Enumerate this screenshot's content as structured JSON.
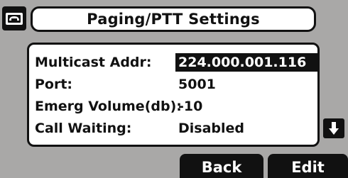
{
  "header": {
    "title": "Paging/PTT Settings",
    "line_icon": "phone-handset-icon"
  },
  "settings": {
    "rows": [
      {
        "label": "Multicast Addr:",
        "value": "224.000.001.116",
        "selected": true
      },
      {
        "label": "Port:",
        "value": "5001",
        "selected": false
      },
      {
        "label": "Emerg Volume(db):",
        "value": "-10",
        "selected": false
      },
      {
        "label": "Call Waiting:",
        "value": "Disabled",
        "selected": false
      }
    ],
    "scroll_icon": "arrow-down-icon"
  },
  "softkeys": {
    "back_label": "Back",
    "edit_label": "Edit"
  },
  "colors": {
    "background": "#a9a8a7",
    "foreground": "#111111",
    "highlight_text": "#ffffff"
  }
}
